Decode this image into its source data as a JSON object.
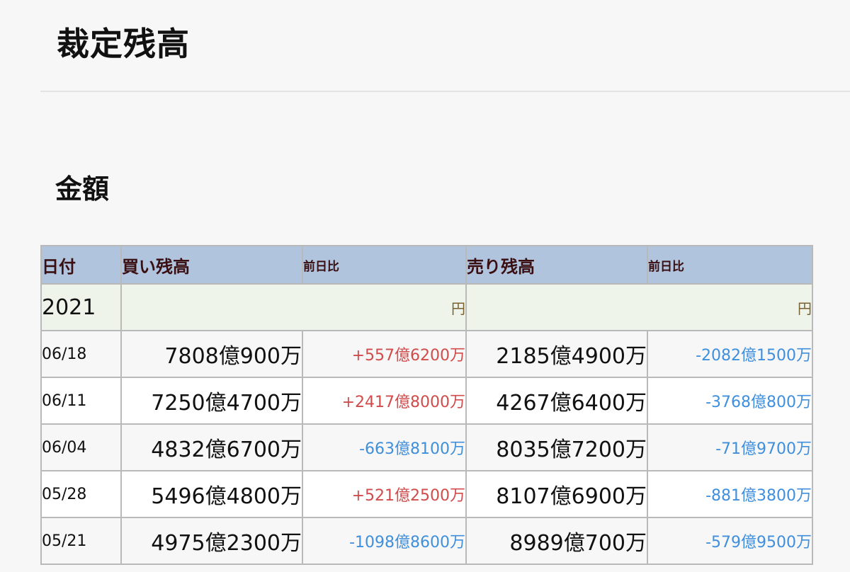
{
  "page": {
    "title": "裁定残高",
    "section_title": "金額"
  },
  "table": {
    "headers": {
      "date": "日付",
      "buy": "買い残高",
      "buy_change": "前日比",
      "sell": "売り残高",
      "sell_change": "前日比"
    },
    "year": "2021",
    "unit_buy": "円",
    "unit_sell": "円",
    "rows": [
      {
        "date": "06/18",
        "buy": "7808億900万",
        "buy_change": "+557億6200万",
        "sell": "2185億4900万",
        "sell_change": "-2082億1500万"
      },
      {
        "date": "06/11",
        "buy": "7250億4700万",
        "buy_change": "+2417億8000万",
        "sell": "4267億6400万",
        "sell_change": "-3768億800万"
      },
      {
        "date": "06/04",
        "buy": "4832億6700万",
        "buy_change": "-663億8100万",
        "sell": "8035億7200万",
        "sell_change": "-71億9700万"
      },
      {
        "date": "05/28",
        "buy": "5496億4800万",
        "buy_change": "+521億2500万",
        "sell": "8107億6900万",
        "sell_change": "-881億3800万"
      },
      {
        "date": "05/21",
        "buy": "4975億2300万",
        "buy_change": "-1098億8600万",
        "sell": "8989億700万",
        "sell_change": "-579億9500万"
      }
    ]
  },
  "colors": {
    "header_bg": "#b0c4de",
    "year_row_bg": "#eef4ea",
    "positive": "#d24b4b",
    "negative": "#3f8fdc"
  }
}
